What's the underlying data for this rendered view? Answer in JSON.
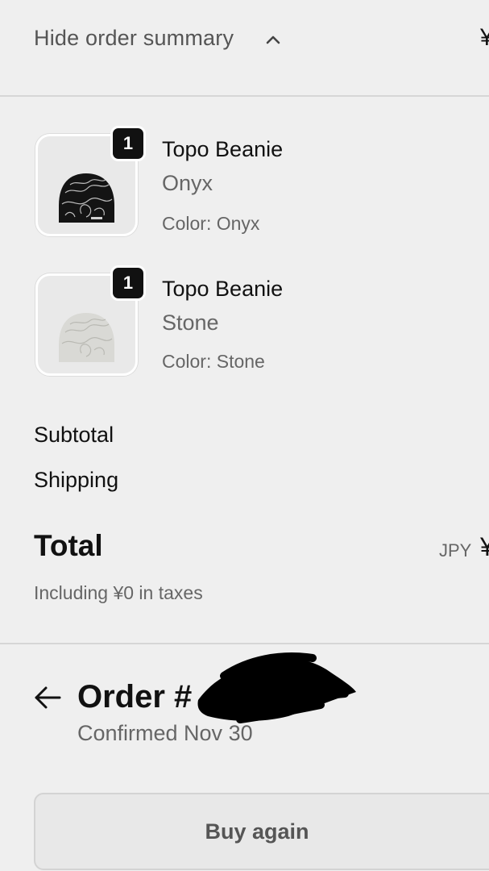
{
  "summary_toggle": {
    "label": "Hide order summary",
    "icon": "chevron-up-icon",
    "price": "¥"
  },
  "line_items": [
    {
      "quantity": "1",
      "title": "Topo Beanie",
      "variant": "Onyx",
      "option": "Color: Onyx",
      "image": "topo-beanie-onyx-image"
    },
    {
      "quantity": "1",
      "title": "Topo Beanie",
      "variant": "Stone",
      "option": "Color: Stone",
      "image": "topo-beanie-stone-image"
    }
  ],
  "totals": {
    "subtotal_label": "Subtotal",
    "shipping_label": "Shipping",
    "total_label": "Total",
    "currency": "JPY",
    "total_price": "¥",
    "taxes_note": "Including ¥0 in taxes"
  },
  "order": {
    "back_icon": "back-arrow-icon",
    "title": "Order #",
    "confirmed": "Confirmed Nov 30"
  },
  "actions": {
    "buy_again": "Buy again"
  },
  "colors": {
    "background": "#efefef",
    "divider": "#d6d6d6",
    "primary_text": "#111111",
    "secondary_text": "#666666",
    "badge": "#111111"
  }
}
